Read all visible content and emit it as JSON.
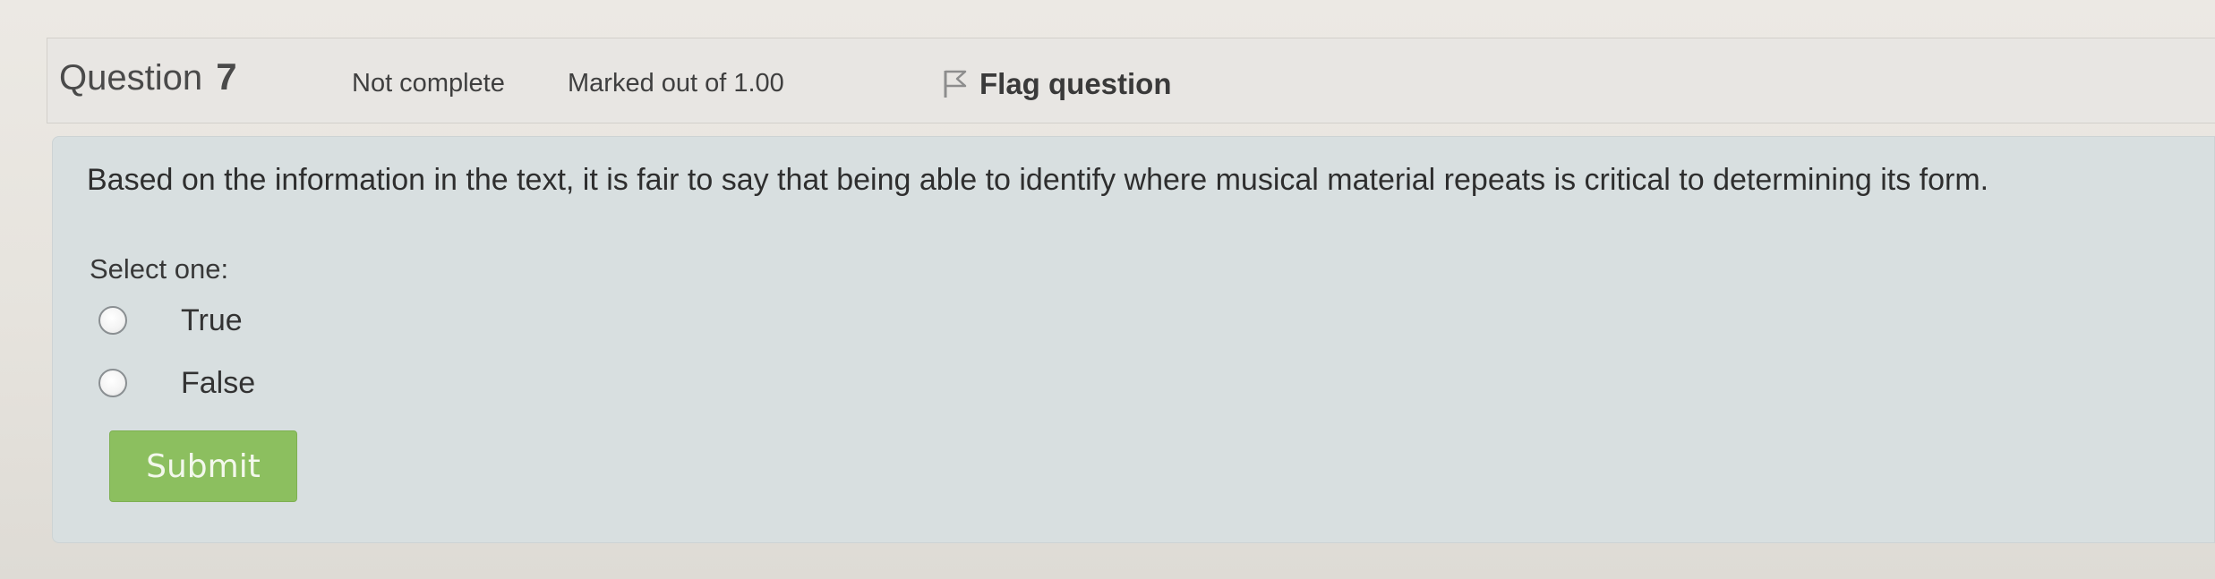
{
  "question_info": {
    "label": "Question",
    "number": "7",
    "state": "Not complete",
    "grade": "Marked out of 1.00",
    "flag_label": "Flag question",
    "flag_icon": "flag-outline-icon"
  },
  "question": {
    "text": "Based on the information in the text, it is fair to say that being able to identify where musical material repeats is critical to determining its form.",
    "prompt": "Select one:",
    "options": [
      {
        "label": "True",
        "selected": false
      },
      {
        "label": "False",
        "selected": false
      }
    ]
  },
  "actions": {
    "submit_label": "Submit"
  },
  "colors": {
    "submit_bg": "#8cbf5f",
    "content_bg": "#d8dfe0",
    "info_bg": "#e8e6e3"
  }
}
